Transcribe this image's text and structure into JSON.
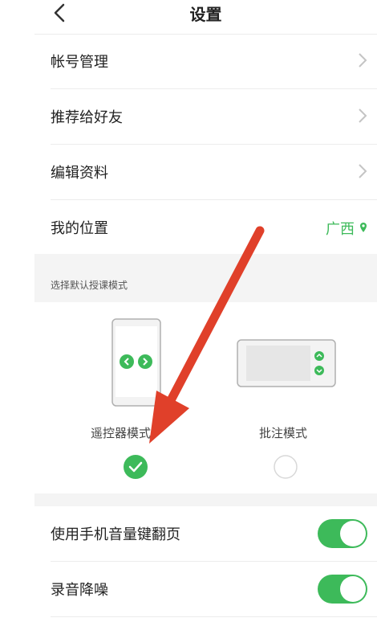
{
  "header": {
    "title": "设置"
  },
  "menu": {
    "account": "帐号管理",
    "recommend": "推荐给好友",
    "edit_profile": "编辑资料",
    "location_label": "我的位置",
    "location_value": "广西"
  },
  "mode_section": {
    "label": "选择默认授课模式",
    "remote_label": "遥控器模式",
    "annotate_label": "批注模式",
    "selected": "remote"
  },
  "settings": {
    "volume_flip": "使用手机音量键翻页",
    "volume_flip_on": true,
    "noise_reduction": "录音降噪",
    "noise_reduction_on": true
  },
  "colors": {
    "accent": "#3dba5a",
    "annotation_arrow": "#e0402a"
  }
}
